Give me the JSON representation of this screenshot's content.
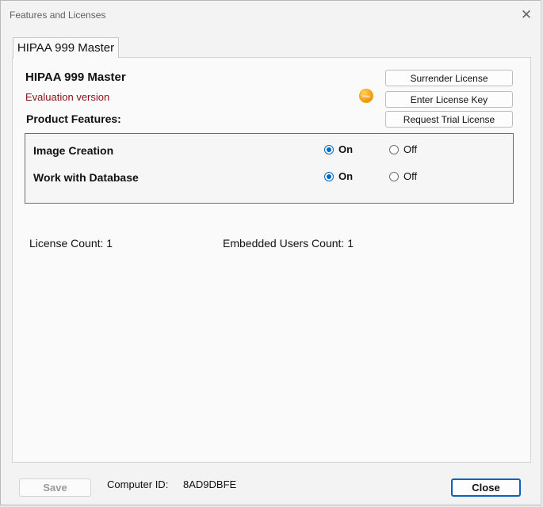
{
  "window": {
    "title": "Features and Licenses",
    "close_glyph": "✕"
  },
  "tab": {
    "label": "HIPAA 999 Master"
  },
  "product": {
    "name": "HIPAA 999 Master",
    "status": "Evaluation version",
    "features_heading": "Product Features:",
    "trial_icon": "trial-badge-icon",
    "trial_badge_text": "TRIAL"
  },
  "actions": {
    "surrender": "Surrender License",
    "enter_key": "Enter License Key",
    "request_trial": "Request Trial License"
  },
  "features": [
    {
      "name": "Image Creation",
      "on_label": "On",
      "off_label": "Off",
      "selected": "On"
    },
    {
      "name": "Work with Database",
      "on_label": "On",
      "off_label": "Off",
      "selected": "On"
    }
  ],
  "counts": {
    "license": "License Count: 1",
    "embedded_users": "Embedded Users Count: 1"
  },
  "footer": {
    "save": "Save",
    "computer_id_label": "Computer ID:",
    "computer_id_value": "8AD9DBFE",
    "close": "Close"
  },
  "colors": {
    "accent": "#0067c0",
    "evaluation_text": "#8b1010",
    "trial_badge": "#f6a81c"
  }
}
